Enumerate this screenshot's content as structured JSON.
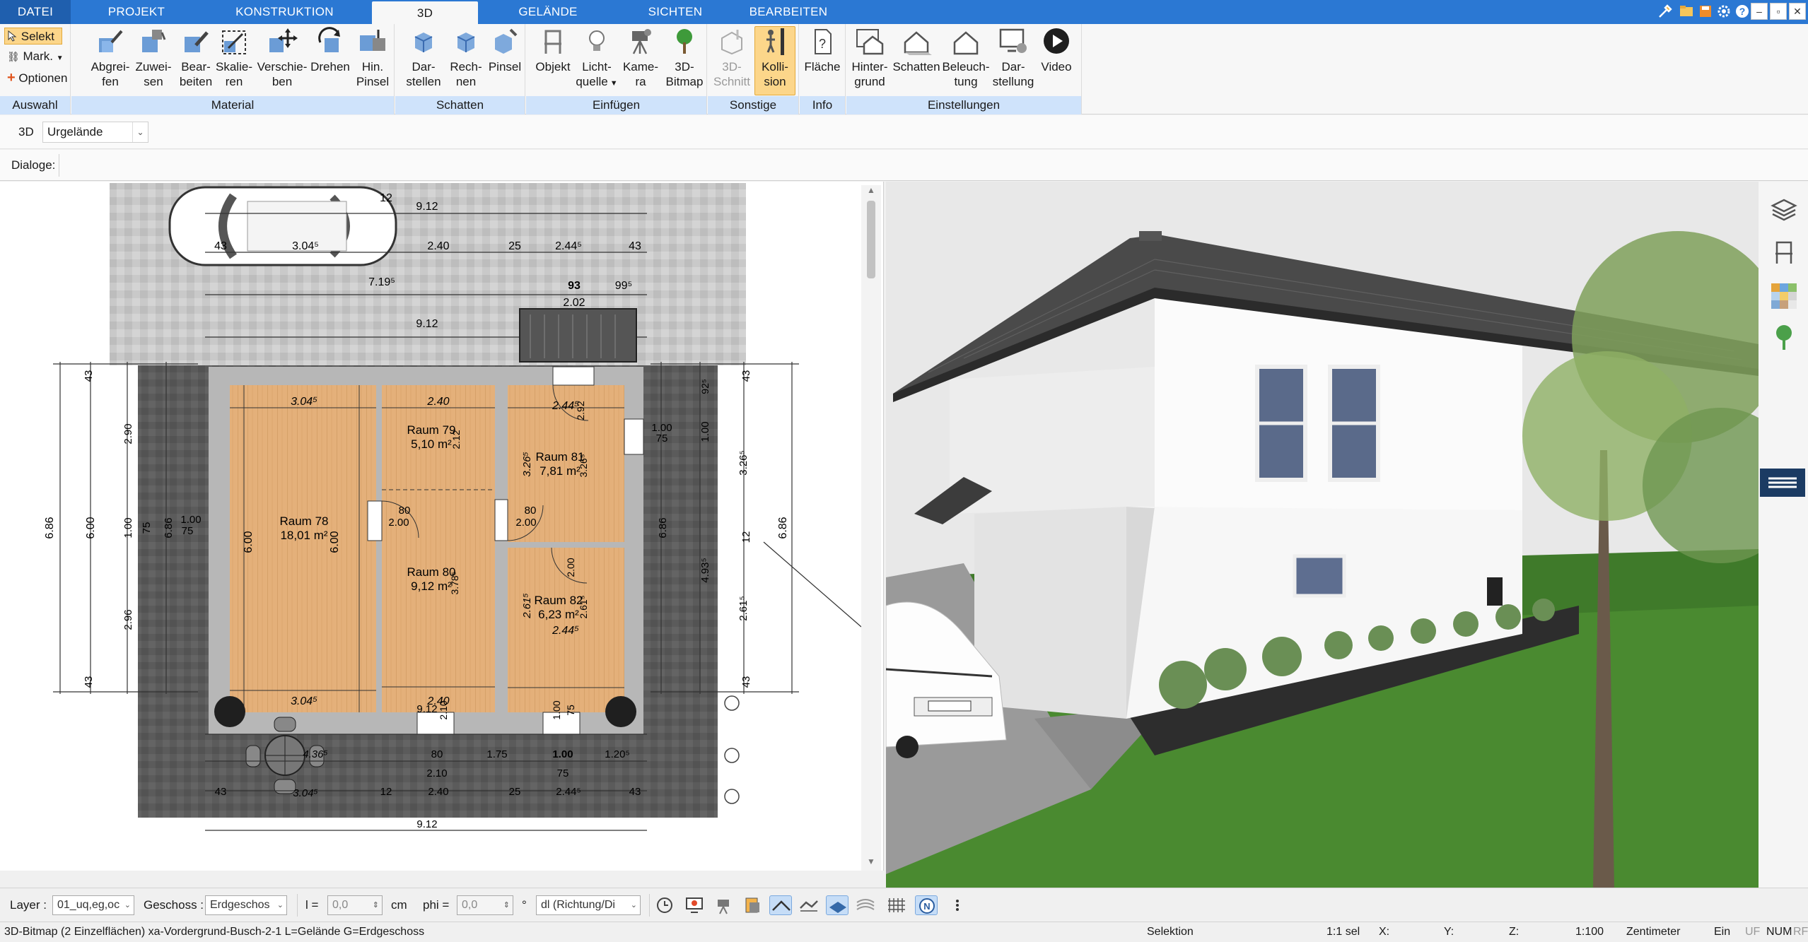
{
  "tabs": [
    {
      "label": "DATEI"
    },
    {
      "label": "PROJEKT"
    },
    {
      "label": "KONSTRUKTION"
    },
    {
      "label": "3D"
    },
    {
      "label": "GELÄNDE"
    },
    {
      "label": "SICHTEN"
    },
    {
      "label": "BEARBEITEN"
    }
  ],
  "window_controls": {
    "minimize": "–",
    "restore": "▫",
    "close": "✕"
  },
  "ribbon": {
    "auswahl": {
      "label": "Auswahl",
      "selekt": "Selekt",
      "mark": "Mark.",
      "optionen": "Optionen"
    },
    "material": {
      "label": "Material",
      "buttons": [
        {
          "l1": "Abgrei-",
          "l2": "fen"
        },
        {
          "l1": "Zuwei-",
          "l2": "sen"
        },
        {
          "l1": "Bear-",
          "l2": "beiten"
        },
        {
          "l1": "Skalie-",
          "l2": "ren"
        },
        {
          "l1": "Verschie-",
          "l2": "ben"
        },
        {
          "l1": "Drehen",
          "l2": ""
        },
        {
          "l1": "Hin.",
          "l2": "Pinsel"
        }
      ]
    },
    "schatten": {
      "label": "Schatten",
      "buttons": [
        {
          "l1": "Dar-",
          "l2": "stellen"
        },
        {
          "l1": "Rech-",
          "l2": "nen"
        },
        {
          "l1": "Pinsel",
          "l2": ""
        }
      ]
    },
    "einfuegen": {
      "label": "Einfügen",
      "buttons": [
        {
          "l1": "Objekt",
          "l2": ""
        },
        {
          "l1": "Licht-",
          "l2": "quelle"
        },
        {
          "l1": "Kame-",
          "l2": "ra"
        },
        {
          "l1": "3D-",
          "l2": "Bitmap"
        }
      ]
    },
    "sonstige": {
      "label": "Sonstige",
      "buttons": [
        {
          "l1": "3D-",
          "l2": "Schnitt"
        },
        {
          "l1": "Kolli-",
          "l2": "sion"
        }
      ]
    },
    "info": {
      "label": "Info",
      "buttons": [
        {
          "l1": "Fläche",
          "l2": ""
        }
      ]
    },
    "einstellungen": {
      "label": "Einstellungen",
      "buttons": [
        {
          "l1": "Hinter-",
          "l2": "grund"
        },
        {
          "l1": "Schatten",
          "l2": ""
        },
        {
          "l1": "Beleuch-",
          "l2": "tung"
        },
        {
          "l1": "Dar-",
          "l2": "stellung"
        },
        {
          "l1": "Video",
          "l2": ""
        }
      ]
    }
  },
  "row3d": {
    "label": "3D",
    "select_value": "Urgelände"
  },
  "dialoge": {
    "label": "Dialoge:"
  },
  "plan": {
    "dims": {
      "d912a": "9.12",
      "d3045a": "3.04⁵",
      "d43a": "43",
      "d240a": "2.40",
      "d25a": "25",
      "d2445a": "2.44⁵",
      "d43b": "43",
      "d12a": "12",
      "d7195": "7.19⁵",
      "d93": "93",
      "d995": "99⁵",
      "d202": "2.02",
      "d912b": "9.12",
      "r78_w": "3.04⁵",
      "r78_name": "Raum 78",
      "r78_area": "18,01 m²",
      "r78_h": "6.00",
      "r78_h2": "6.00",
      "r78_bot": "3.04⁵",
      "r79_w": "2.40",
      "r79_name": "Raum 79",
      "r79_area": "5,10 m²",
      "r79_h": "2.12",
      "r80_name": "Raum 80",
      "r80_area": "9,12 m²",
      "r80_h": "3.78⁵",
      "r80_w": "2.40",
      "r81_w": "2.44⁵",
      "r81_name": "Raum 81",
      "r81_area": "7,81 m²",
      "r81_h": "3.26⁵",
      "r81_h2": "3.26⁵",
      "r82_name": "Raum 82",
      "r82_area": "6,23 m²",
      "r82_h": "2.61⁵",
      "r82_h2": "2.61⁵",
      "r82_w": "2.44⁵",
      "door80a": "80",
      "door200a": "2.00",
      "door80b": "80",
      "door200b": "2.00",
      "d92": "2.92",
      "d2005": "2.00",
      "l43": "43",
      "l290": "2.90",
      "l686": "6.86",
      "l600": "6.00",
      "l100": "1.00",
      "l75": "75",
      "l686b": "6.86",
      "l100b": "1.00",
      "l75b": "75",
      "l296": "2.96",
      "l43b": "43",
      "r43": "43",
      "r925": "92⁵",
      "r100": "1.00",
      "r75": "75",
      "r100b": "1.00",
      "r3265": "3.26⁵",
      "r12": "12",
      "r686": "6.86",
      "r4935": "4.93⁵",
      "r2615": "2.61⁵",
      "r43b": "43",
      "r686b": "6.86",
      "b9125": "9.12",
      "b210": "2.10",
      "b100": "1.00",
      "b75": "75",
      "b80": "80",
      "b210b": "2.10",
      "b175": "1.75",
      "b100b": "1.00",
      "b75b": "75",
      "b1205": "1.20⁵",
      "b4365": "4.36⁵",
      "b43": "43",
      "b3045": "3.04⁵",
      "b12": "12",
      "b240": "2.40",
      "b25": "25",
      "b2445": "2.44⁵",
      "b43b": "43",
      "b912": "9.12"
    }
  },
  "toolbar": {
    "layer_label": "Layer :",
    "layer_value": "01_uq,eg,oc",
    "geschoss_label": "Geschoss :",
    "geschoss_value": "Erdgeschos",
    "l_label": "l =",
    "l_value": "0,0",
    "l_unit": "cm",
    "phi_label": "phi =",
    "phi_value": "0,0",
    "phi_unit": "°",
    "dl_value": "dl (Richtung/Di"
  },
  "status": {
    "message": "3D-Bitmap (2 Einzelflächen) xa-Vordergrund-Busch-2-1 L=Gelände G=Erdgeschoss",
    "mode": "Selektion",
    "sel": "1:1 sel",
    "x": "X:",
    "y": "Y:",
    "z": "Z:",
    "scale": "1:100",
    "unit": "Zentimeter",
    "ein": "Ein",
    "uf": "UF",
    "num": "NUM",
    "rf": "RF"
  },
  "colors": {
    "tab_blue": "#2b78d3",
    "ribbon_group": "#cfe3fb",
    "active_orange": "#fcd68a",
    "floor_wood": "#e3ad6f",
    "grass": "#3f7a2a"
  }
}
